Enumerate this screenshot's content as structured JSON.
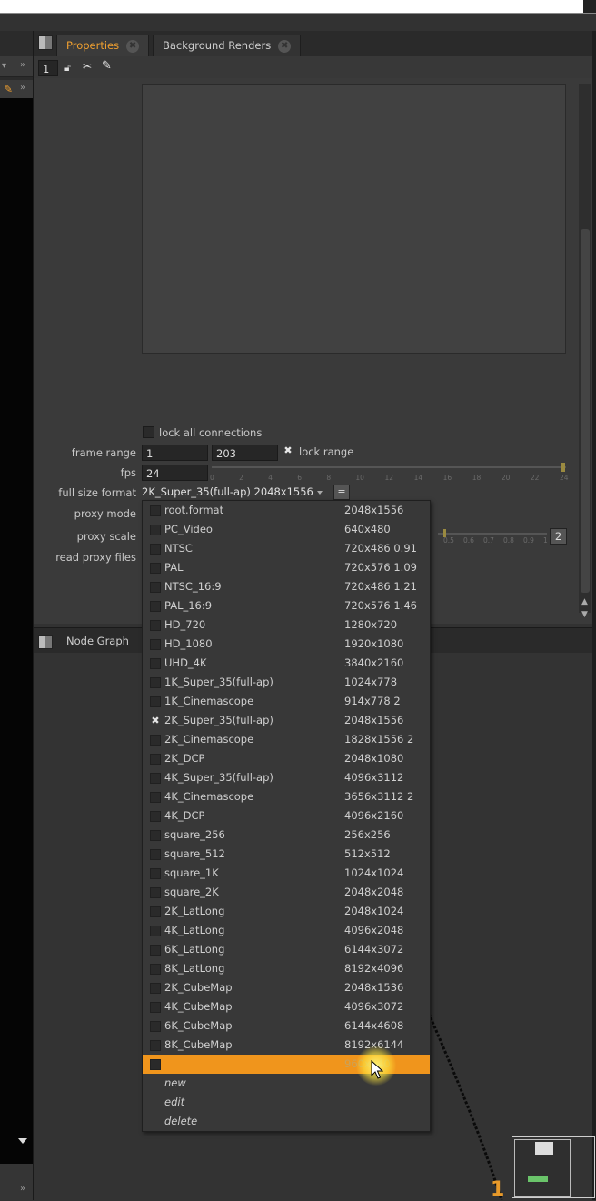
{
  "properties_panel": {
    "tabs": [
      {
        "label": "Properties",
        "active": true
      },
      {
        "label": "Background Renders",
        "active": false
      }
    ],
    "toolbar": {
      "node_count": "1"
    },
    "knobs": {
      "lock_all_connections_label": "lock all connections",
      "frame_range_label": "frame range",
      "frame_range_start": "1",
      "frame_range_end": "203",
      "lock_range_label": "lock range",
      "fps_label": "fps",
      "fps_value": "24",
      "fps_slider_ticks": [
        "0",
        "2",
        "4",
        "6",
        "8",
        "10",
        "12",
        "14",
        "16",
        "18",
        "20",
        "22",
        "24"
      ],
      "full_size_format_label": "full size format",
      "full_size_format_value": "2K_Super_35(full-ap) 2048x1556",
      "format_eq_button": "=",
      "proxy_mode_label": "proxy mode",
      "proxy_scale_label": "proxy scale",
      "proxy_scale_ticks": [
        "0.5",
        "0.6",
        "0.7",
        "0.8",
        "0.9",
        "1"
      ],
      "proxy_scale_value": "2",
      "read_proxy_files_label": "read proxy files"
    }
  },
  "node_graph": {
    "tab_label": "Node Graph",
    "node_label": "1"
  },
  "format_dropdown": {
    "items": [
      {
        "name": "root.format",
        "res": "2048x1556",
        "checked": false
      },
      {
        "name": "PC_Video",
        "res": "640x480",
        "checked": false
      },
      {
        "name": "NTSC",
        "res": "720x486 0.91",
        "checked": false
      },
      {
        "name": "PAL",
        "res": "720x576 1.09",
        "checked": false
      },
      {
        "name": "NTSC_16:9",
        "res": "720x486 1.21",
        "checked": false
      },
      {
        "name": "PAL_16:9",
        "res": "720x576 1.46",
        "checked": false
      },
      {
        "name": "HD_720",
        "res": "1280x720",
        "checked": false
      },
      {
        "name": "HD_1080",
        "res": "1920x1080",
        "checked": false
      },
      {
        "name": "UHD_4K",
        "res": "3840x2160",
        "checked": false
      },
      {
        "name": "1K_Super_35(full-ap)",
        "res": "1024x778",
        "checked": false
      },
      {
        "name": "1K_Cinemascope",
        "res": "914x778 2",
        "checked": false
      },
      {
        "name": "2K_Super_35(full-ap)",
        "res": "2048x1556",
        "checked": true
      },
      {
        "name": "2K_Cinemascope",
        "res": "1828x1556 2",
        "checked": false
      },
      {
        "name": "2K_DCP",
        "res": "2048x1080",
        "checked": false
      },
      {
        "name": "4K_Super_35(full-ap)",
        "res": "4096x3112",
        "checked": false
      },
      {
        "name": "4K_Cinemascope",
        "res": "3656x3112 2",
        "checked": false
      },
      {
        "name": "4K_DCP",
        "res": "4096x2160",
        "checked": false
      },
      {
        "name": "square_256",
        "res": "256x256",
        "checked": false
      },
      {
        "name": "square_512",
        "res": "512x512",
        "checked": false
      },
      {
        "name": "square_1K",
        "res": "1024x1024",
        "checked": false
      },
      {
        "name": "square_2K",
        "res": "2048x2048",
        "checked": false
      },
      {
        "name": "2K_LatLong",
        "res": "2048x1024",
        "checked": false
      },
      {
        "name": "4K_LatLong",
        "res": "4096x2048",
        "checked": false
      },
      {
        "name": "6K_LatLong",
        "res": "6144x3072",
        "checked": false
      },
      {
        "name": "8K_LatLong",
        "res": "8192x4096",
        "checked": false
      },
      {
        "name": "2K_CubeMap",
        "res": "2048x1536",
        "checked": false
      },
      {
        "name": "4K_CubeMap",
        "res": "4096x3072",
        "checked": false
      },
      {
        "name": "6K_CubeMap",
        "res": "6144x4608",
        "checked": false
      },
      {
        "name": "8K_CubeMap",
        "res": "8192x6144",
        "checked": false
      },
      {
        "name": "",
        "res": "960x540",
        "checked": false,
        "highlighted": true
      }
    ],
    "actions": [
      "new",
      "edit",
      "delete"
    ]
  },
  "colors": {
    "accent": "#f0951c",
    "tab_active_text": "#f0a030",
    "node_number": "#e89a2a"
  },
  "icons": [
    "panel-float-icon",
    "tab-close-icon",
    "lock-icon",
    "disconnect-icon",
    "edit-pencil-icon",
    "chevron-down-icon",
    "dropdown-arrow-icon",
    "check-x-icon",
    "mouse-pointer-icon"
  ]
}
